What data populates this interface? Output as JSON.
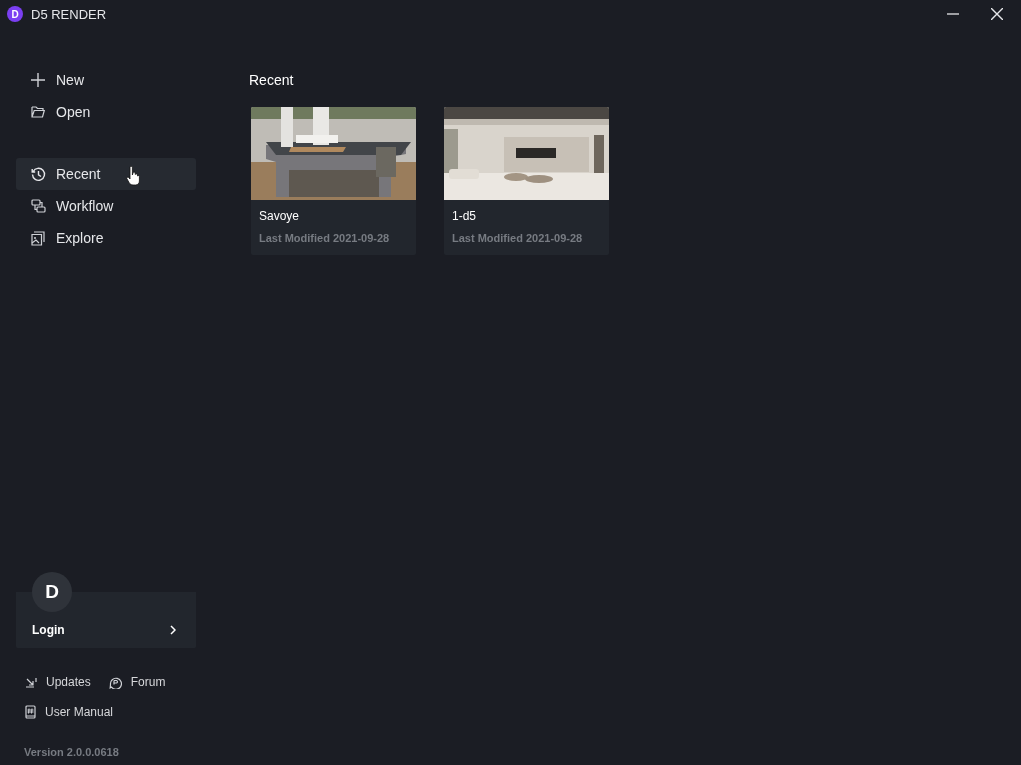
{
  "window": {
    "logo_letter": "D",
    "title": "D5 RENDER"
  },
  "sidebar": {
    "actions": [
      {
        "label": "New"
      },
      {
        "label": "Open"
      }
    ],
    "nav": [
      {
        "label": "Recent",
        "selected": true
      },
      {
        "label": "Workflow",
        "selected": false
      },
      {
        "label": "Explore",
        "selected": false
      }
    ],
    "account": {
      "avatar": "D",
      "label": "Login"
    },
    "links": [
      {
        "label": "Updates"
      },
      {
        "label": "Forum"
      },
      {
        "label": "User Manual"
      }
    ],
    "version": "Version 2.0.0.0618"
  },
  "main": {
    "heading": "Recent",
    "projects": [
      {
        "name": "Savoye",
        "modified": "Last Modified 2021-09-28",
        "kind": "picture"
      },
      {
        "name": "1-d5",
        "modified": "Last Modified 2021-09-28",
        "kind": "picture"
      }
    ]
  }
}
